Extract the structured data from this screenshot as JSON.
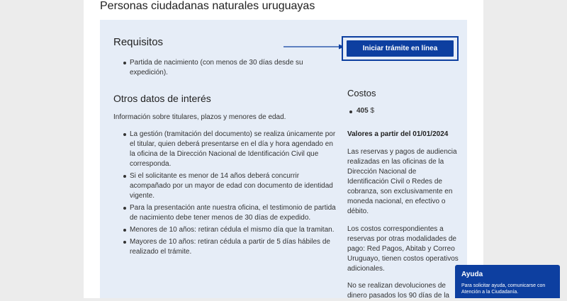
{
  "page_title": "Personas ciudadanas naturales uruguayas",
  "requisitos": {
    "title": "Requisitos",
    "items": [
      "Partida de nacimiento (con menos de 30 días desde su expedición)."
    ]
  },
  "cta": {
    "label": "Iniciar trámite en línea"
  },
  "otros": {
    "title": "Otros datos de interés",
    "intro": "Información sobre titulares, plazos y menores de edad.",
    "items": [
      "La gestión (tramitación del documento) se realiza únicamente por el titular, quien deberá presentarse en el día y hora agendado en la oficina de la Dirección Nacional de Identificación Civil que corresponda.",
      "Si el solicitante es menor de 14 años deberá concurrir acompañado por un mayor de edad con documento de identidad vigente.",
      "Para la presentación ante nuestra oficina, el testimonio de partida de nacimiento debe tener menos de 30 días de expedido.",
      "Menores de 10 años: retiran cédula el mismo día que la tramitan.",
      "Mayores de 10 años: retiran cédula a partir de 5 días hábiles de realizado el trámite."
    ]
  },
  "costos": {
    "title": "Costos",
    "amount": "405",
    "currency": "$",
    "valores_title": "Valores a partir del 01/01/2024",
    "paragraphs": [
      "Las reservas y pagos de audiencia realizadas en las oficinas de la Dirección Nacional de Identificación Civil o Redes de cobranza, son exclusivamente en moneda nacional, en efectivo o débito.",
      "Los costos correspondientes a reservas por otras modalidades de pago: Red Pagos, Abitab y Correo Uruguayo, tienen costos operativos adicionales.",
      "No se realizan devoluciones de dinero pasados los 90 días de la"
    ]
  },
  "help": {
    "title": "Ayuda",
    "text": "Para solicitar ayuda, comunicarse con Atención a la Ciudadanía."
  },
  "colors": {
    "primary": "#0d3fa0",
    "card_bg": "#e6edf7"
  }
}
